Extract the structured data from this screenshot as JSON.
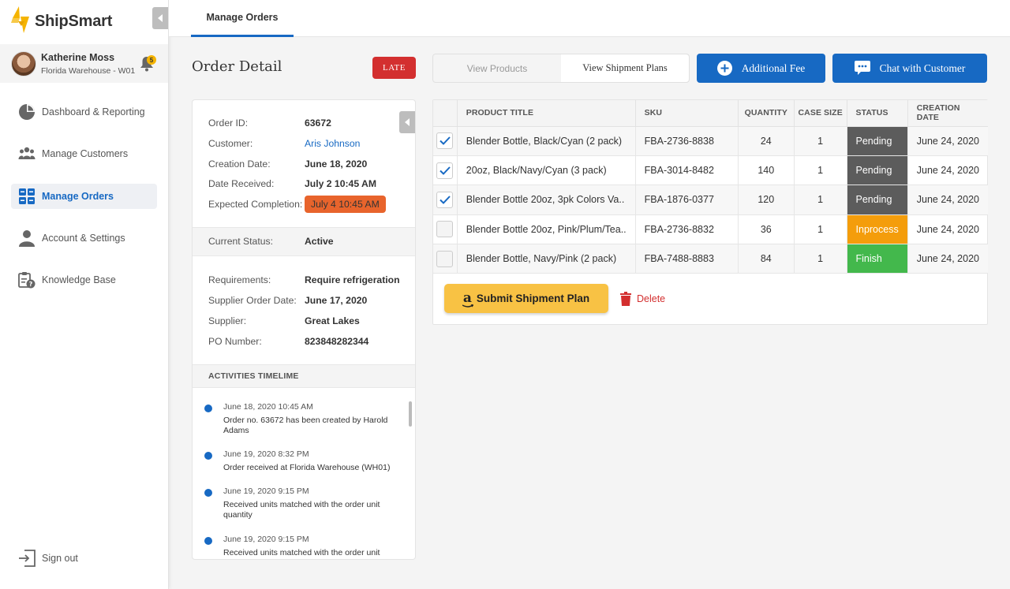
{
  "app": {
    "name": "ShipSmart"
  },
  "user": {
    "name": "Katherine Moss",
    "location": "Florida Warehouse - W01",
    "notifications": "5"
  },
  "nav": {
    "items": [
      {
        "label": "Dashboard & Reporting"
      },
      {
        "label": "Manage Customers"
      },
      {
        "label": "Manage Orders"
      },
      {
        "label": "Account & Settings"
      },
      {
        "label": "Knowledge Base"
      }
    ],
    "signout": "Sign out"
  },
  "topbar": {
    "tab": "Manage Orders"
  },
  "header": {
    "title": "Order Detail",
    "late_badge": "LATE",
    "view_products": "View Products",
    "view_shipment_plans": "View Shipment Plans",
    "additional_fee": "Additional Fee",
    "chat": "Chat with Customer"
  },
  "order": {
    "id_label": "Order ID:",
    "id": "63672",
    "customer_label": "Customer:",
    "customer": "Aris Johnson",
    "creation_label": "Creation Date:",
    "creation": "June 18, 2020",
    "received_label": "Date Received:",
    "received": "July 2 10:45 AM",
    "expected_label": "Expected Completion:",
    "expected": "July 4 10:45 AM",
    "status_label": "Current Status:",
    "status": "Active",
    "requirements_label": "Requirements:",
    "requirements": "Require refrigeration",
    "supplier_date_label": "Supplier Order Date:",
    "supplier_date": "June 17, 2020",
    "supplier_label": "Supplier:",
    "supplier": "Great Lakes",
    "po_label": "PO Number:",
    "po": "823848282344"
  },
  "timeline": {
    "heading": "ACTIVITIES TIMELIME",
    "items": [
      {
        "date": "June 18, 2020 10:45 AM",
        "text": "Order no. 63672 has been created by Harold Adams"
      },
      {
        "date": "June 19, 2020 8:32 PM",
        "text": "Order received at Florida Warehouse (WH01)"
      },
      {
        "date": "June 19, 2020 9:15 PM",
        "text": "Received units matched with the order unit quantity"
      },
      {
        "date": "June 19, 2020 9:15 PM",
        "text": "Received units matched with the order unit"
      }
    ]
  },
  "table": {
    "headers": [
      "PRODUCT TITLE",
      "SKU",
      "QUANTITY",
      "CASE SIZE",
      "STATUS",
      "CREATION DATE"
    ],
    "rows": [
      {
        "checked": true,
        "title": "Blender Bottle, Black/Cyan (2 pack)",
        "sku": "FBA-2736-8838",
        "qty": "24",
        "case": "1",
        "status": "Pending",
        "date": "June 24, 2020"
      },
      {
        "checked": true,
        "title": "20oz, Black/Navy/Cyan (3 pack)",
        "sku": "FBA-3014-8482",
        "qty": "140",
        "case": "1",
        "status": "Pending",
        "date": "June 24, 2020"
      },
      {
        "checked": true,
        "title": "Blender Bottle 20oz, 3pk Colors Va..",
        "sku": "FBA-1876-0377",
        "qty": "120",
        "case": "1",
        "status": "Pending",
        "date": "June 24, 2020"
      },
      {
        "checked": false,
        "title": "Blender Bottle 20oz, Pink/Plum/Tea..",
        "sku": "FBA-2736-8832",
        "qty": "36",
        "case": "1",
        "status": "Inprocess",
        "date": "June 24, 2020"
      },
      {
        "checked": false,
        "title": "Blender Bottle, Navy/Pink (2 pack)",
        "sku": "FBA-7488-8883",
        "qty": "84",
        "case": "1",
        "status": "Finish",
        "date": "June 24, 2020"
      }
    ],
    "submit": "Submit Shipment Plan",
    "delete": "Delete"
  },
  "colors": {
    "accent": "#1769c3",
    "late": "#d32f2f",
    "pending": "#5c5c5c",
    "inprocess": "#f49d0b",
    "finish": "#43b84c",
    "amazon": "#f8c244"
  }
}
